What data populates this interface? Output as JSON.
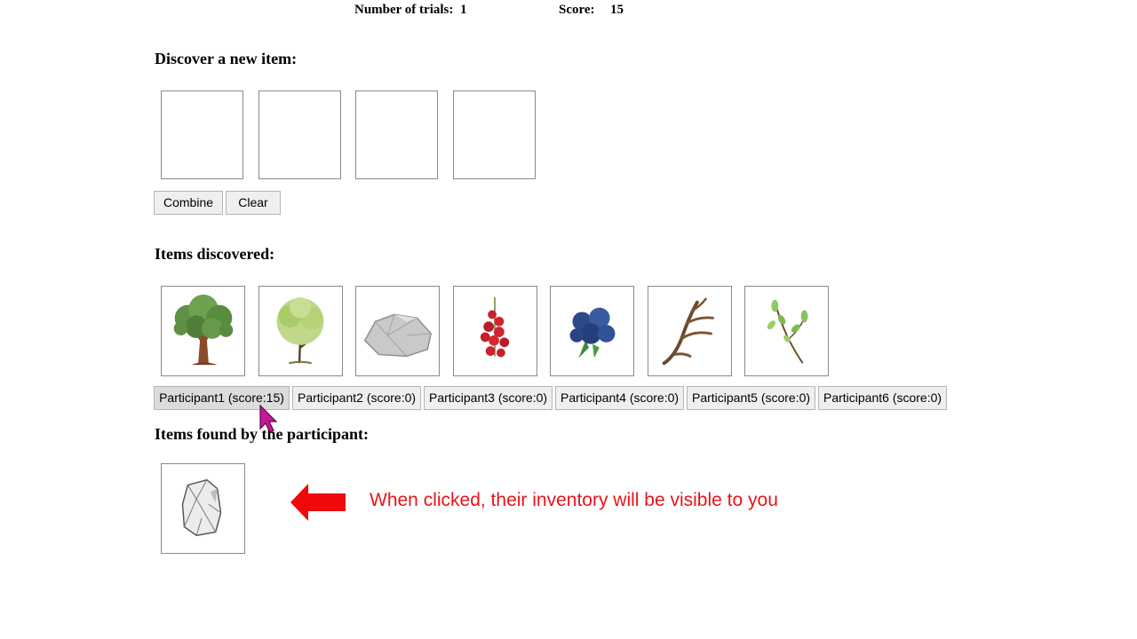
{
  "header": {
    "trials_label": "Number of trials:",
    "trials_value": "1",
    "score_label": "Score:",
    "score_value": "15"
  },
  "discover": {
    "heading": "Discover a new item:",
    "combine_label": "Combine",
    "clear_label": "Clear"
  },
  "discovered": {
    "heading": "Items discovered:",
    "items": [
      {
        "icon": "oak-tree-icon"
      },
      {
        "icon": "young-tree-icon"
      },
      {
        "icon": "rock-icon"
      },
      {
        "icon": "red-currant-icon"
      },
      {
        "icon": "blueberry-icon"
      },
      {
        "icon": "antler-icon"
      },
      {
        "icon": "twig-icon"
      }
    ]
  },
  "participants": [
    {
      "label": "Participant1 (score:15)"
    },
    {
      "label": "Participant2 (score:0)"
    },
    {
      "label": "Participant3 (score:0)"
    },
    {
      "label": "Participant4 (score:0)"
    },
    {
      "label": "Participant5 (score:0)"
    },
    {
      "label": "Participant6 (score:0)"
    }
  ],
  "participant_items": {
    "heading": "Items found by the participant:",
    "items": [
      {
        "icon": "flint-stone-icon"
      }
    ]
  },
  "annotation": {
    "text": "When clicked, their inventory will be visible to you",
    "color": "#e8141b"
  },
  "cursor": {
    "icon": "mouse-pointer-icon",
    "color": "#c8169a"
  }
}
